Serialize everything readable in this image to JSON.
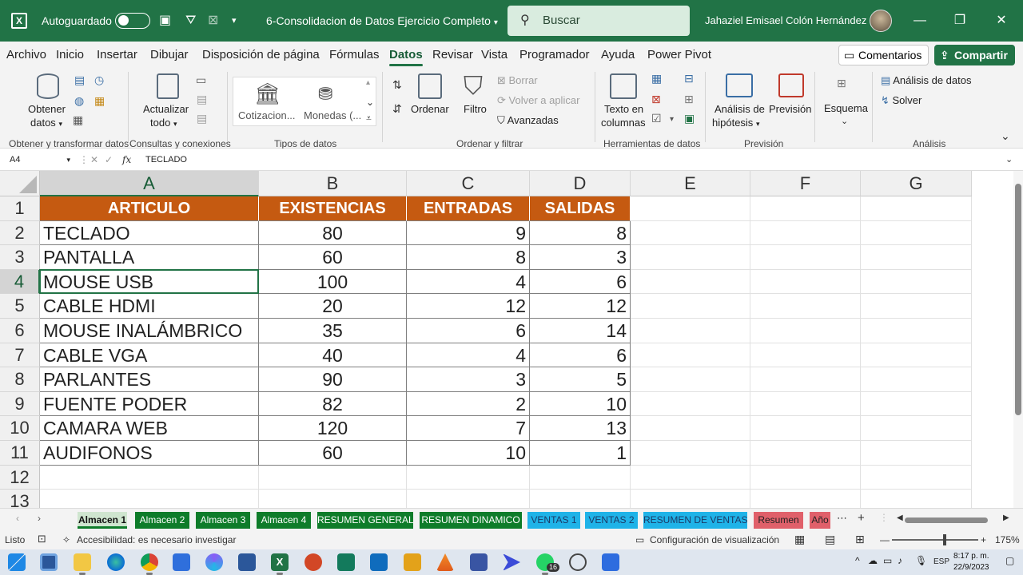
{
  "titlebar": {
    "autosave_label": "Autoguardado",
    "document_title": "6-Consolidacion de Datos Ejercicio Completo",
    "search_placeholder": "Buscar",
    "user_name": "Jahaziel Emisael Colón Hernández"
  },
  "menu": {
    "tabs": [
      "Archivo",
      "Inicio",
      "Insertar",
      "Dibujar",
      "Disposición de página",
      "Fórmulas",
      "Datos",
      "Revisar",
      "Vista",
      "Programador",
      "Ayuda",
      "Power Pivot"
    ],
    "active_tab": "Datos",
    "comments_label": "Comentarios",
    "share_label": "Compartir"
  },
  "ribbon": {
    "get_data_line1": "Obtener",
    "get_data_line2": "datos",
    "refresh_line1": "Actualizar",
    "refresh_line2": "todo",
    "group_get_transform": "Obtener y transformar datos",
    "group_queries": "Consultas y conexiones",
    "data_type_1": "Cotizacion...",
    "data_type_2": "Monedas (...",
    "group_data_types": "Tipos de datos",
    "sort_label": "Ordenar",
    "filter_label": "Filtro",
    "clear_label": "Borrar",
    "reapply_label": "Volver a aplicar",
    "advanced_label": "Avanzadas",
    "group_sort_filter": "Ordenar y filtrar",
    "text_to_columns_line1": "Texto en",
    "text_to_columns_line2": "columnas",
    "group_data_tools": "Herramientas de datos",
    "whatif_line1": "Análisis de",
    "whatif_line2": "hipótesis",
    "forecast_label": "Previsión",
    "group_forecast": "Previsión",
    "outline_label": "Esquema",
    "data_analysis_label": "Análisis de datos",
    "solver_label": "Solver",
    "group_analysis": "Análisis"
  },
  "formula_bar": {
    "name_box": "A4",
    "formula": "TECLADO"
  },
  "grid": {
    "columns": [
      "A",
      "B",
      "C",
      "D",
      "E",
      "F",
      "G"
    ],
    "rows": [
      "1",
      "2",
      "3",
      "4",
      "5",
      "6",
      "7",
      "8",
      "9",
      "10",
      "11",
      "12",
      "13"
    ],
    "headers": [
      "ARTICULO",
      "EXISTENCIAS",
      "ENTRADAS",
      "SALIDAS"
    ],
    "records": [
      [
        "TECLADO",
        "80",
        "9",
        "8"
      ],
      [
        "PANTALLA",
        "60",
        "8",
        "3"
      ],
      [
        "MOUSE USB",
        "100",
        "4",
        "6"
      ],
      [
        "CABLE HDMI",
        "20",
        "12",
        "12"
      ],
      [
        "MOUSE INALÁMBRICO",
        "35",
        "6",
        "14"
      ],
      [
        "CABLE VGA",
        "40",
        "4",
        "6"
      ],
      [
        "PARLANTES",
        "90",
        "3",
        "5"
      ],
      [
        "FUENTE PODER",
        "82",
        "2",
        "10"
      ],
      [
        "CAMARA WEB",
        "120",
        "7",
        "13"
      ],
      [
        "AUDIFONOS",
        "60",
        "10",
        "1"
      ]
    ],
    "header_color": "#c55a11"
  },
  "sheets": [
    {
      "name": "Almacen 1",
      "style": "active"
    },
    {
      "name": "Almacen 2",
      "style": "green"
    },
    {
      "name": "Almacen 3",
      "style": "green"
    },
    {
      "name": "Almacen 4",
      "style": "green"
    },
    {
      "name": "RESUMEN GENERAL",
      "style": "green"
    },
    {
      "name": "RESUMEN DINAMICO",
      "style": "green"
    },
    {
      "name": "VENTAS 1",
      "style": "blue"
    },
    {
      "name": "VENTAS 2",
      "style": "blue"
    },
    {
      "name": "RESUMEN DE VENTAS",
      "style": "blue"
    },
    {
      "name": "Resumen",
      "style": "red"
    },
    {
      "name": "Año",
      "style": "red"
    }
  ],
  "status": {
    "ready": "Listo",
    "accessibility": "Accesibilidad: es necesario investigar",
    "display_settings": "Configuración de visualización",
    "zoom": "175%"
  },
  "taskbar": {
    "language": "ESP",
    "time": "8:17 p. m.",
    "date": "22/9/2023",
    "badge": "16"
  },
  "colors": {
    "excel_green": "#217346",
    "table_header": "#c55a11",
    "sheet_green": "#0e7c2a",
    "sheet_blue": "#1fb3e8",
    "sheet_red": "#e0606a"
  }
}
